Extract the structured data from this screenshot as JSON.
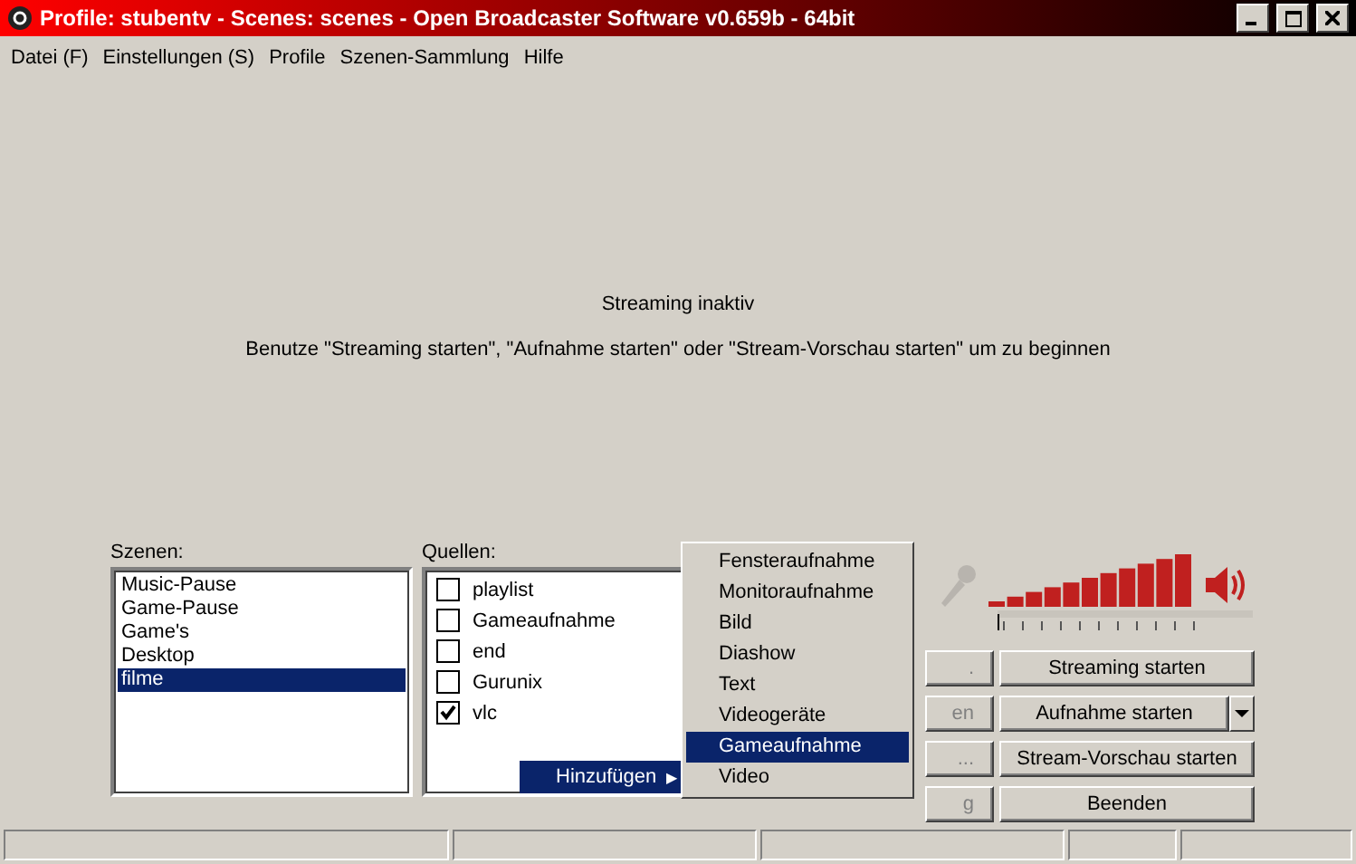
{
  "window": {
    "title": "Profile: stubentv - Scenes: scenes - Open Broadcaster Software v0.659b - 64bit"
  },
  "menu": [
    "Datei (F)",
    "Einstellungen (S)",
    "Profile",
    "Szenen-Sammlung",
    "Hilfe"
  ],
  "preview": {
    "status": "Streaming inaktiv",
    "hint": "Benutze \"Streaming starten\", \"Aufnahme starten\" oder \"Stream-Vorschau starten\" um zu beginnen"
  },
  "scenes": {
    "label": "Szenen:",
    "items": [
      {
        "name": "Music-Pause",
        "selected": false
      },
      {
        "name": "Game-Pause",
        "selected": false
      },
      {
        "name": "Game's",
        "selected": false
      },
      {
        "name": "Desktop",
        "selected": false
      },
      {
        "name": "filme",
        "selected": true
      }
    ]
  },
  "sources": {
    "label": "Quellen:",
    "items": [
      {
        "name": "playlist",
        "checked": false
      },
      {
        "name": "Gameaufnahme",
        "checked": false
      },
      {
        "name": "end",
        "checked": false
      },
      {
        "name": "Gurunix",
        "checked": false
      },
      {
        "name": "vlc",
        "checked": true
      }
    ]
  },
  "context_menu": {
    "item": "Hinzufügen",
    "arrow": "▶",
    "submenu": [
      {
        "label": "Fensteraufnahme",
        "selected": false
      },
      {
        "label": "Monitoraufnahme",
        "selected": false
      },
      {
        "label": "Bild",
        "selected": false
      },
      {
        "label": "Diashow",
        "selected": false
      },
      {
        "label": "Text",
        "selected": false
      },
      {
        "label": "Videogeräte",
        "selected": false
      },
      {
        "label": "Gameaufnahme",
        "selected": true
      },
      {
        "label": "Video",
        "selected": false
      }
    ]
  },
  "left_buttons": [
    ".",
    "en",
    "...",
    "g"
  ],
  "right_buttons": [
    {
      "label": "Streaming starten",
      "dropdown": false
    },
    {
      "label": "Aufnahme starten",
      "dropdown": true
    },
    {
      "label": "Stream-Vorschau starten",
      "dropdown": false
    },
    {
      "label": "Beenden",
      "dropdown": false
    }
  ]
}
